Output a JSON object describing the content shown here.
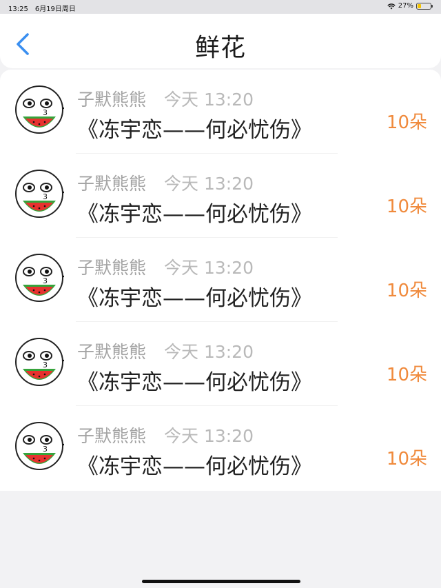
{
  "status_bar": {
    "time": "13:25",
    "date": "6月19日周日",
    "battery": "27%",
    "battery_level": 0.27
  },
  "nav": {
    "title": "鲜花",
    "back_icon": "chevron-left-icon"
  },
  "rows": [
    {
      "name": "子默熊熊",
      "time": "今天 13:20",
      "title": "《冻宇恋——何必忧伤》",
      "count": "10朵"
    },
    {
      "name": "子默熊熊",
      "time": "今天 13:20",
      "title": "《冻宇恋——何必忧伤》",
      "count": "10朵"
    },
    {
      "name": "子默熊熊",
      "time": "今天 13:20",
      "title": "《冻宇恋——何必忧伤》",
      "count": "10朵"
    },
    {
      "name": "子默熊熊",
      "time": "今天 13:20",
      "title": "《冻宇恋——何必忧伤》",
      "count": "10朵"
    },
    {
      "name": "子默熊熊",
      "time": "今天 13:20",
      "title": "《冻宇恋——何必忧伤》",
      "count": "10朵"
    }
  ],
  "colors": {
    "accent": "#3a8ff0",
    "count": "#f08a3c"
  }
}
